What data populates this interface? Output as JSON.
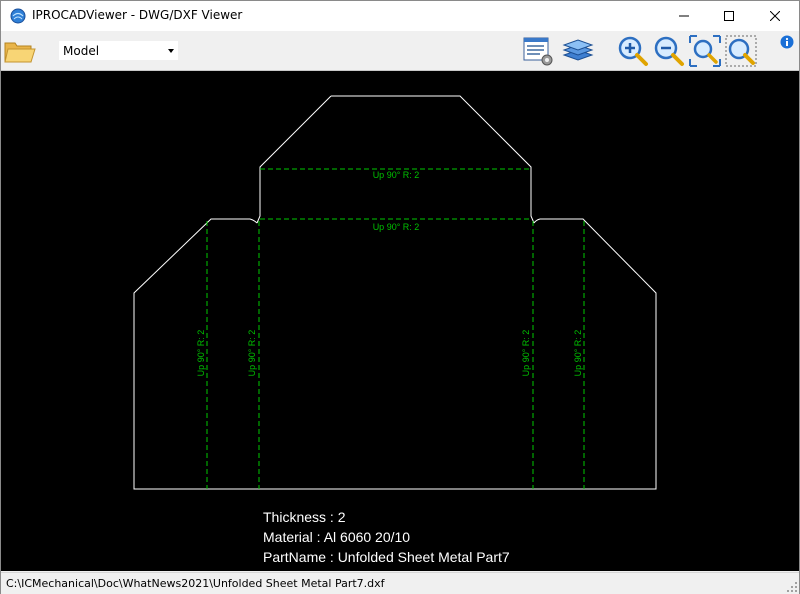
{
  "window": {
    "title": "IPROCADViewer - DWG/DXF Viewer",
    "controls": [
      "minimize-icon",
      "maximize-icon",
      "close-icon"
    ]
  },
  "toolbar": {
    "layout_selected": "Model",
    "buttons": [
      "open-folder-icon",
      "layer-settings-icon",
      "layers-icon",
      "zoom-in-icon",
      "zoom-out-icon",
      "zoom-extents-icon",
      "zoom-window-icon",
      "info-icon"
    ]
  },
  "drawing": {
    "line_color": "#ffffff",
    "bend_color": "#00c000",
    "bend_labels": {
      "horizontal_top": "Up 90° R: 2",
      "horizontal_bottom": "Up 90° R: 2",
      "vertical_1": "Up 90° R: 2",
      "vertical_2": "Up 90° R: 2",
      "vertical_3": "Up 90° R: 2",
      "vertical_4": "Up 90° R: 2"
    },
    "notes": {
      "thickness": "Thickness : 2",
      "material": "Material : Al 6060 20/10",
      "partname": "PartName : Unfolded Sheet Metal Part7"
    }
  },
  "status": {
    "path": "C:\\ICMechanical\\Doc\\WhatNews2021\\Unfolded Sheet Metal Part7.dxf"
  }
}
